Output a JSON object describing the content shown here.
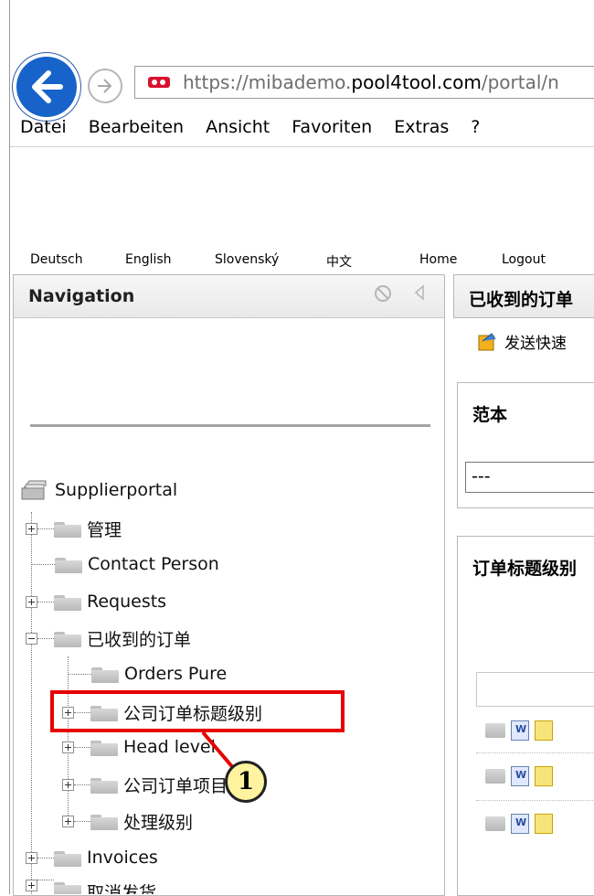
{
  "browser": {
    "url_scheme": "https://",
    "url_host_prefix": "mibademo.",
    "url_host_domain": "pool4tool.com",
    "url_path": "/portal/n"
  },
  "menu": [
    "Datei",
    "Bearbeiten",
    "Ansicht",
    "Favoriten",
    "Extras",
    "?"
  ],
  "topbar": {
    "languages": [
      "Deutsch",
      "English",
      "Slovenský",
      "中文"
    ],
    "home": "Home",
    "logout": "Logout"
  },
  "navigation": {
    "title": "Navigation",
    "root": "Supplierportal",
    "items": {
      "guanli": "管理",
      "contact": "Contact Person",
      "requests": "Requests",
      "received_orders": "已收到的订单",
      "orders_pure": "Orders Pure",
      "header_level": "公司订单标题级别",
      "head_level": "Head level",
      "item_level": "公司订单项目级别",
      "processing_level": "处理级别",
      "invoices": "Invoices",
      "cancel_shipping": "取消发货"
    }
  },
  "right_panel": {
    "title": "已收到的订单",
    "send_link": "发送快速",
    "template_label": "范本",
    "template_value": "---",
    "header_section_label": "订单标题级别"
  },
  "annotation": {
    "callout_number": "1"
  },
  "colors": {
    "highlight": "#e60000",
    "callout_fill": "#fff3a0",
    "back_button": "#1763c9"
  }
}
